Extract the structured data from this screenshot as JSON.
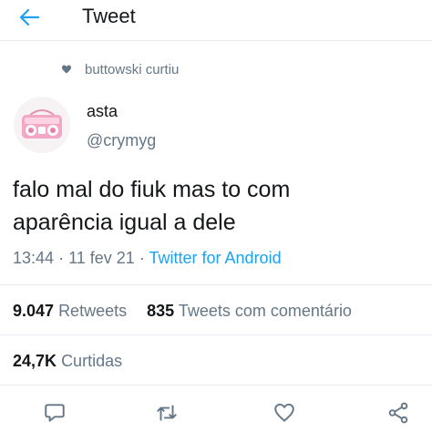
{
  "header": {
    "title": "Tweet",
    "back_icon": "arrow-left-icon",
    "accent": "#1da1f2"
  },
  "social_context": {
    "icon": "heart-icon",
    "text": "buttowski curtiu"
  },
  "author": {
    "display_name": "asta",
    "handle": "@crymyg",
    "avatar": "pink-cassette-player-avatar"
  },
  "tweet": {
    "text": "falo mal do fiuk mas to com\naparência  igual a dele",
    "time": "13:44",
    "date": "11 fev 21",
    "separator": "·",
    "source": "Twitter for Android"
  },
  "stats": {
    "retweets_count": "9.047",
    "retweets_label": "Retweets",
    "quotes_count": "835",
    "quotes_label": "Tweets com comentário",
    "likes_count": "24,7K",
    "likes_label": "Curtidas"
  },
  "actions": [
    "reply-icon",
    "retweet-icon",
    "like-icon",
    "share-icon"
  ],
  "colors": {
    "text": "#14171a",
    "secondary": "#657786",
    "link": "#1da1f2",
    "divider": "#e6ecf0"
  }
}
